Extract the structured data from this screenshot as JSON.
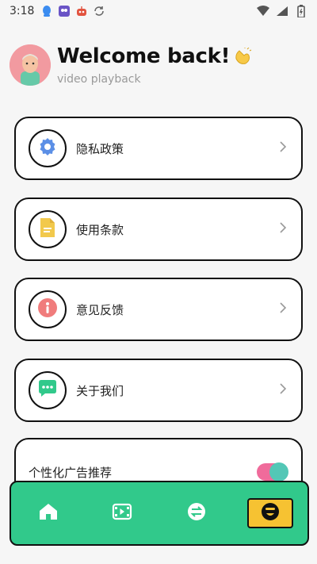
{
  "status_bar": {
    "time": "3:18"
  },
  "header": {
    "welcome": "Welcome back!",
    "subtitle": "video playback"
  },
  "menu": [
    {
      "label": "隐私政策",
      "icon": "gear-icon",
      "icon_color": "#5b8fe6"
    },
    {
      "label": "使用条款",
      "icon": "document-icon",
      "icon_color": "#f2c94c"
    },
    {
      "label": "意见反馈",
      "icon": "info-icon",
      "icon_color": "#f07c7c"
    },
    {
      "label": "关于我们",
      "icon": "chat-icon",
      "icon_color": "#31c98b"
    }
  ],
  "personalized_ads": {
    "label": "个性化广告推荐",
    "enabled": true
  },
  "colors": {
    "accent_green": "#31c98b",
    "active_nav_yellow": "#f6c232",
    "toggle_track": "#f06b9b",
    "toggle_knob": "#53c7b6"
  },
  "bottom_nav": {
    "items": [
      {
        "name": "home",
        "icon": "home-icon"
      },
      {
        "name": "video",
        "icon": "video-icon"
      },
      {
        "name": "swap",
        "icon": "swap-icon"
      },
      {
        "name": "profile",
        "icon": "face-icon",
        "active": true
      }
    ]
  }
}
